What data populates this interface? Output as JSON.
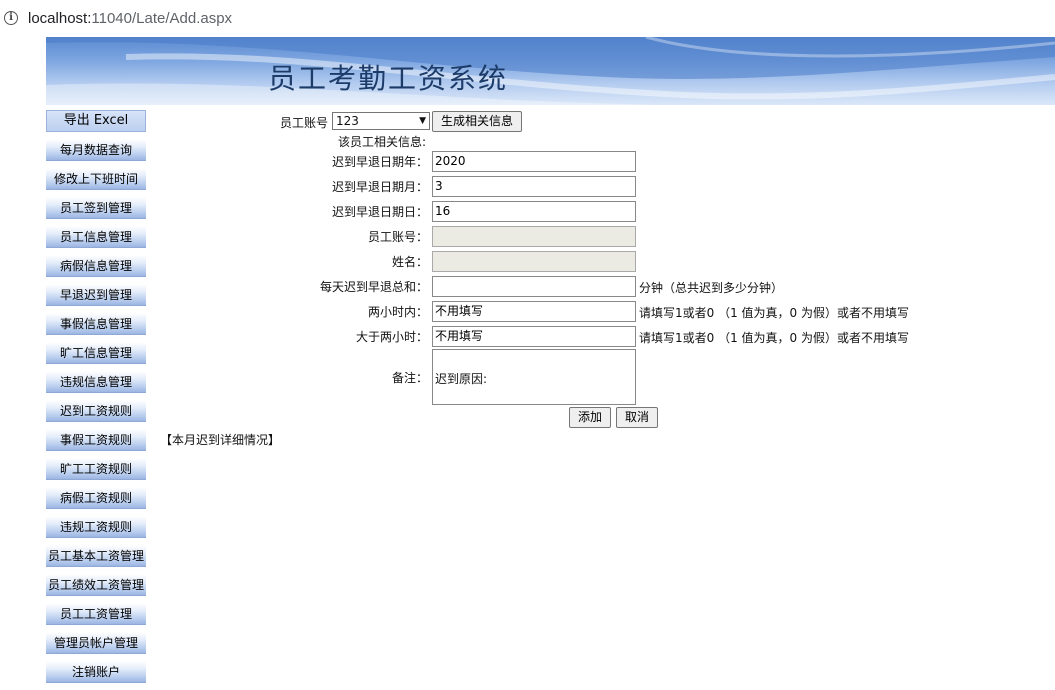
{
  "browser": {
    "url_host": "localhost:",
    "url_path": "11040/Late/Add.aspx"
  },
  "header": {
    "title": "员工考勤工资系统"
  },
  "sidebar": {
    "items": [
      {
        "label": "导出 Excel"
      },
      {
        "label": "每月数据查询"
      },
      {
        "label": "修改上下班时间"
      },
      {
        "label": "员工签到管理"
      },
      {
        "label": "员工信息管理"
      },
      {
        "label": "病假信息管理"
      },
      {
        "label": "早退迟到管理"
      },
      {
        "label": "事假信息管理"
      },
      {
        "label": "旷工信息管理"
      },
      {
        "label": "违规信息管理"
      },
      {
        "label": "迟到工资规则"
      },
      {
        "label": "事假工资规则"
      },
      {
        "label": "旷工工资规则"
      },
      {
        "label": "病假工资规则"
      },
      {
        "label": "违规工资规则"
      },
      {
        "label": "员工基本工资管理"
      },
      {
        "label": "员工绩效工资管理"
      },
      {
        "label": "员工工资管理"
      },
      {
        "label": "管理员帐户管理"
      },
      {
        "label": "注销账户"
      }
    ]
  },
  "form": {
    "account_label": "员工账号",
    "account_selected": "123",
    "generate_button": "生成相关信息",
    "related_info_label": "该员工相关信息:",
    "year_label": "迟到早退日期年：",
    "year_value": "2020",
    "month_label": "迟到早退日期月：",
    "month_value": "3",
    "day_label": "迟到早退日期日：",
    "day_value": "16",
    "emp_account_label": "员工账号：",
    "emp_account_value": "",
    "name_label": "姓名：",
    "name_value": "",
    "total_label": "每天迟到早退总和：",
    "total_value": "",
    "total_hint": "分钟（总共迟到多少分钟）",
    "within2h_label": "两小时内：",
    "within2h_value": "不用填写",
    "within2h_hint": "请填写1或者0 （1 值为真，0 为假）或者不用填写",
    "over2h_label": "大于两小时：",
    "over2h_value": "不用填写",
    "over2h_hint": "请填写1或者0 （1 值为真，0 为假）或者不用填写",
    "remark_label": "备注：",
    "remark_value": "迟到原因:",
    "add_button": "添加",
    "cancel_button": "取消"
  },
  "details_label": "【本月迟到详细情况】"
}
